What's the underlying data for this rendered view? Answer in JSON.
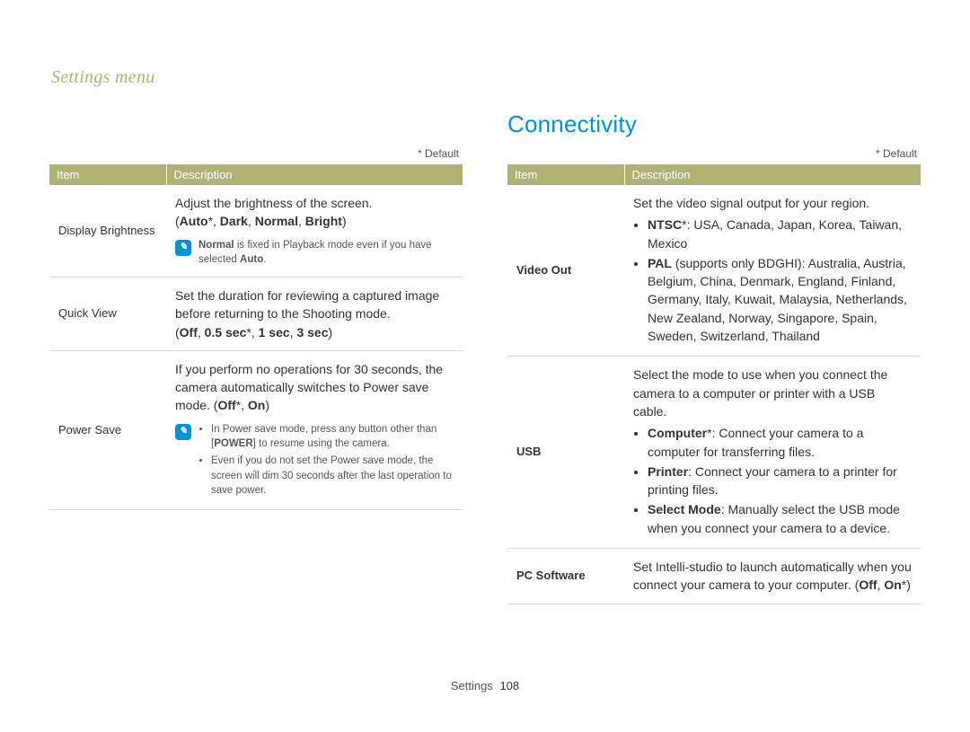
{
  "breadcrumb": "Settings menu",
  "section_title": "Connectivity",
  "default_note": "* Default",
  "table_headers": {
    "item": "Item",
    "description": "Description"
  },
  "left_table": {
    "rows": [
      {
        "item": "Display Brightness",
        "desc_intro": "Adjust the brightness of the screen.",
        "options_line_open": "(",
        "options": [
          {
            "t": "Auto",
            "d": "*"
          },
          {
            "sep": ", "
          },
          {
            "t": "Dark"
          },
          {
            "sep": ", "
          },
          {
            "t": "Normal"
          },
          {
            "sep": ", "
          },
          {
            "t": "Bright"
          }
        ],
        "options_line_close": ")",
        "note_icon": "✎",
        "note_html": "<b>Normal</b> is fixed in Playback mode even if you have selected <b>Auto</b>."
      },
      {
        "item": "Quick View",
        "desc_intro": "Set the duration for reviewing a captured image before returning to the Shooting mode.",
        "options_line_open": "(",
        "options": [
          {
            "t": "Off"
          },
          {
            "sep": ", "
          },
          {
            "t": "0.5 sec",
            "d": "*"
          },
          {
            "sep": ", "
          },
          {
            "t": "1 sec"
          },
          {
            "sep": ", "
          },
          {
            "t": "3 sec"
          }
        ],
        "options_line_close": ")"
      },
      {
        "item": "Power Save",
        "desc_intro": "If you perform no operations for 30 seconds, the camera automatically switches to Power save mode. (",
        "inline_options": [
          {
            "t": "Off",
            "d": "*"
          },
          {
            "sep": ", "
          },
          {
            "t": "On"
          }
        ],
        "inline_close": ")",
        "note_icon": "✎",
        "note_list": [
          "In Power save mode, press any button other than [<b>POWER</b>] to resume using the camera.",
          "Even if you do not set the Power save mode, the screen will dim 30 seconds after the last operation to save power."
        ]
      }
    ]
  },
  "right_table": {
    "rows": [
      {
        "item": "Video Out",
        "desc_intro": "Set the video signal output for your region.",
        "list": [
          "<b>NTSC</b>*: USA, Canada, Japan, Korea, Taiwan, Mexico",
          "<b>PAL</b> (supports only BDGHI): Australia, Austria, Belgium, China, Denmark, England, Finland, Germany, Italy, Kuwait, Malaysia, Netherlands, New Zealand, Norway, Singapore, Spain, Sweden, Switzerland, Thailand"
        ]
      },
      {
        "item": "USB",
        "desc_intro": "Select the mode to use when you connect the camera to a computer or printer with a USB cable.",
        "list": [
          "<b>Computer</b>*: Connect your camera to a computer for transferring files.",
          "<b>Printer</b>: Connect your camera to a printer for printing files.",
          "<b>Select Mode</b>: Manually select the USB mode when you connect your camera to a device."
        ]
      },
      {
        "item": "PC Software",
        "desc_intro": "Set Intelli-studio to launch automatically when you connect your camera to your computer. (",
        "inline_options": [
          {
            "t": "Off"
          },
          {
            "sep": ", "
          },
          {
            "t": "On",
            "d": "*"
          }
        ],
        "inline_close": ")"
      }
    ]
  },
  "footer": {
    "section": "Settings",
    "page": "108"
  }
}
